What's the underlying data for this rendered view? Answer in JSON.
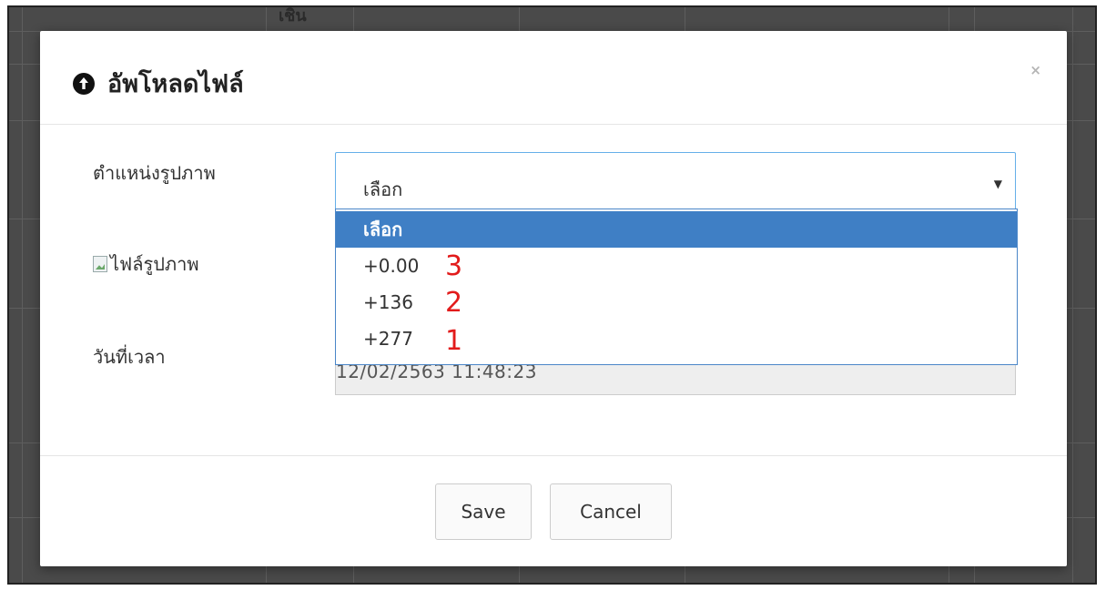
{
  "background": {
    "partial_header_text": "เชิน"
  },
  "modal": {
    "title": "อัพโหลดไฟล์",
    "close_label": "×",
    "fields": {
      "position_label": "ตำแหน่งรูปภาพ",
      "image_label": "ไฟล์รูปภาพ",
      "datetime_label": "วันที่เวลา"
    },
    "select": {
      "value": "เลือก",
      "caret": "▼",
      "options": [
        {
          "label": "เลือก",
          "selected": true
        },
        {
          "label": "+0.00",
          "annotation": "3"
        },
        {
          "label": "+136",
          "annotation": "2"
        },
        {
          "label": "+277",
          "annotation": "1"
        }
      ]
    },
    "datetime_value": "12/02/2563 11:48:23",
    "buttons": {
      "save": "Save",
      "cancel": "Cancel"
    }
  },
  "colors": {
    "selected_option_bg": "#3f7fc5",
    "annotation": "#e21b1b",
    "focus_border": "#66afe9"
  }
}
